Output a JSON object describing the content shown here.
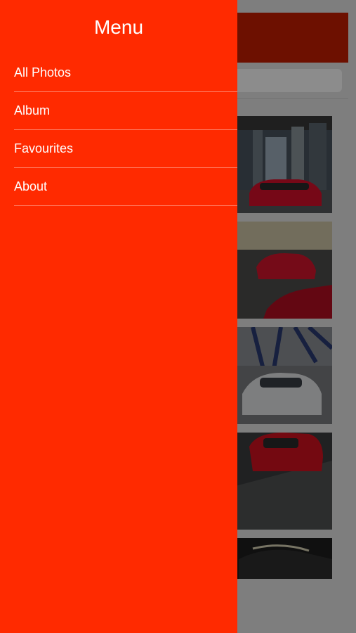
{
  "drawer": {
    "title": "Menu",
    "items": [
      {
        "label": "All Photos"
      },
      {
        "label": "Album"
      },
      {
        "label": "Favourites"
      },
      {
        "label": "About"
      }
    ]
  },
  "colors": {
    "drawer_background": "#ff2a00",
    "header_background": "#c61e00",
    "overlay": "rgba(0,0,0,0.45)"
  },
  "gallery": {
    "tiles": [
      {
        "subject": "red sports car in city street"
      },
      {
        "subject": "red sports car on wet road"
      },
      {
        "subject": "white sports car under structure"
      },
      {
        "subject": "red sports car top view"
      },
      {
        "subject": "dark sports car detail"
      }
    ]
  }
}
